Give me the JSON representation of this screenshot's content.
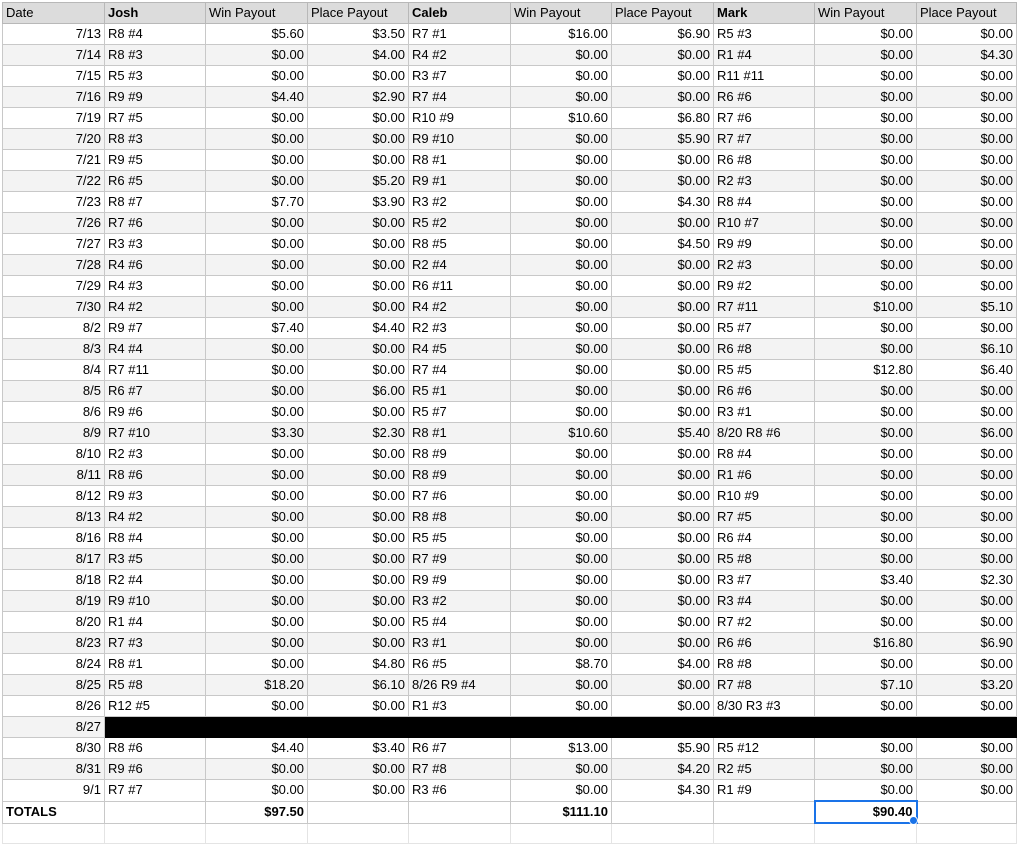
{
  "headers": [
    "Date",
    "Josh",
    "Win Payout",
    "Place Payout",
    "Caleb",
    "Win Payout",
    "Place Payout",
    "Mark",
    "Win Payout",
    "Place Payout"
  ],
  "bold_headers": [
    1,
    4,
    7
  ],
  "rows": [
    [
      "7/13",
      "R8 #4",
      "$5.60",
      "$3.50",
      "R7 #1",
      "$16.00",
      "$6.90",
      "R5 #3",
      "$0.00",
      "$0.00"
    ],
    [
      "7/14",
      "R8 #3",
      "$0.00",
      "$4.00",
      "R4 #2",
      "$0.00",
      "$0.00",
      "R1 #4",
      "$0.00",
      "$4.30"
    ],
    [
      "7/15",
      "R5 #3",
      "$0.00",
      "$0.00",
      "R3 #7",
      "$0.00",
      "$0.00",
      "R11 #11",
      "$0.00",
      "$0.00"
    ],
    [
      "7/16",
      "R9 #9",
      "$4.40",
      "$2.90",
      "R7 #4",
      "$0.00",
      "$0.00",
      "R6 #6",
      "$0.00",
      "$0.00"
    ],
    [
      "7/19",
      "R7 #5",
      "$0.00",
      "$0.00",
      "R10 #9",
      "$10.60",
      "$6.80",
      "R7 #6",
      "$0.00",
      "$0.00"
    ],
    [
      "7/20",
      "R8 #3",
      "$0.00",
      "$0.00",
      "R9 #10",
      "$0.00",
      "$5.90",
      "R7 #7",
      "$0.00",
      "$0.00"
    ],
    [
      "7/21",
      "R9 #5",
      "$0.00",
      "$0.00",
      "R8 #1",
      "$0.00",
      "$0.00",
      "R6 #8",
      "$0.00",
      "$0.00"
    ],
    [
      "7/22",
      "R6 #5",
      "$0.00",
      "$5.20",
      "R9 #1",
      "$0.00",
      "$0.00",
      "R2 #3",
      "$0.00",
      "$0.00"
    ],
    [
      "7/23",
      "R8 #7",
      "$7.70",
      "$3.90",
      "R3 #2",
      "$0.00",
      "$4.30",
      "R8 #4",
      "$0.00",
      "$0.00"
    ],
    [
      "7/26",
      "R7 #6",
      "$0.00",
      "$0.00",
      "R5 #2",
      "$0.00",
      "$0.00",
      "R10 #7",
      "$0.00",
      "$0.00"
    ],
    [
      "7/27",
      "R3 #3",
      "$0.00",
      "$0.00",
      "R8 #5",
      "$0.00",
      "$4.50",
      "R9 #9",
      "$0.00",
      "$0.00"
    ],
    [
      "7/28",
      "R4 #6",
      "$0.00",
      "$0.00",
      "R2 #4",
      "$0.00",
      "$0.00",
      "R2 #3",
      "$0.00",
      "$0.00"
    ],
    [
      "7/29",
      "R4 #3",
      "$0.00",
      "$0.00",
      "R6 #11",
      "$0.00",
      "$0.00",
      "R9 #2",
      "$0.00",
      "$0.00"
    ],
    [
      "7/30",
      "R4 #2",
      "$0.00",
      "$0.00",
      "R4 #2",
      "$0.00",
      "$0.00",
      "R7 #11",
      "$10.00",
      "$5.10"
    ],
    [
      "8/2",
      "R9 #7",
      "$7.40",
      "$4.40",
      "R2 #3",
      "$0.00",
      "$0.00",
      "R5 #7",
      "$0.00",
      "$0.00"
    ],
    [
      "8/3",
      "R4 #4",
      "$0.00",
      "$0.00",
      "R4 #5",
      "$0.00",
      "$0.00",
      "R6 #8",
      "$0.00",
      "$6.10"
    ],
    [
      "8/4",
      "R7 #11",
      "$0.00",
      "$0.00",
      "R7 #4",
      "$0.00",
      "$0.00",
      "R5 #5",
      "$12.80",
      "$6.40"
    ],
    [
      "8/5",
      "R6 #7",
      "$0.00",
      "$6.00",
      "R5 #1",
      "$0.00",
      "$0.00",
      "R6 #6",
      "$0.00",
      "$0.00"
    ],
    [
      "8/6",
      "R9 #6",
      "$0.00",
      "$0.00",
      "R5 #7",
      "$0.00",
      "$0.00",
      "R3 #1",
      "$0.00",
      "$0.00"
    ],
    [
      "8/9",
      "R7 #10",
      "$3.30",
      "$2.30",
      "R8 #1",
      "$10.60",
      "$5.40",
      "8/20 R8 #6",
      "$0.00",
      "$6.00"
    ],
    [
      "8/10",
      "R2 #3",
      "$0.00",
      "$0.00",
      "R8 #9",
      "$0.00",
      "$0.00",
      "R8 #4",
      "$0.00",
      "$0.00"
    ],
    [
      "8/11",
      "R8 #6",
      "$0.00",
      "$0.00",
      "R8 #9",
      "$0.00",
      "$0.00",
      "R1 #6",
      "$0.00",
      "$0.00"
    ],
    [
      "8/12",
      "R9 #3",
      "$0.00",
      "$0.00",
      "R7 #6",
      "$0.00",
      "$0.00",
      "R10 #9",
      "$0.00",
      "$0.00"
    ],
    [
      "8/13",
      "R4 #2",
      "$0.00",
      "$0.00",
      "R8 #8",
      "$0.00",
      "$0.00",
      "R7 #5",
      "$0.00",
      "$0.00"
    ],
    [
      "8/16",
      "R8 #4",
      "$0.00",
      "$0.00",
      "R5 #5",
      "$0.00",
      "$0.00",
      "R6 #4",
      "$0.00",
      "$0.00"
    ],
    [
      "8/17",
      "R3 #5",
      "$0.00",
      "$0.00",
      "R7 #9",
      "$0.00",
      "$0.00",
      "R5 #8",
      "$0.00",
      "$0.00"
    ],
    [
      "8/18",
      "R2 #4",
      "$0.00",
      "$0.00",
      "R9 #9",
      "$0.00",
      "$0.00",
      "R3 #7",
      "$3.40",
      "$2.30"
    ],
    [
      "8/19",
      "R9 #10",
      "$0.00",
      "$0.00",
      "R3 #2",
      "$0.00",
      "$0.00",
      "R3 #4",
      "$0.00",
      "$0.00"
    ],
    [
      "8/20",
      "R1 #4",
      "$0.00",
      "$0.00",
      "R5 #4",
      "$0.00",
      "$0.00",
      "R7 #2",
      "$0.00",
      "$0.00"
    ],
    [
      "8/23",
      "R7 #3",
      "$0.00",
      "$0.00",
      "R3 #1",
      "$0.00",
      "$0.00",
      "R6 #6",
      "$16.80",
      "$6.90"
    ],
    [
      "8/24",
      "R8 #1",
      "$0.00",
      "$4.80",
      "R6 #5",
      "$8.70",
      "$4.00",
      "R8 #8",
      "$0.00",
      "$0.00"
    ],
    [
      "8/25",
      "R5 #8",
      "$18.20",
      "$6.10",
      "8/26 R9 #4",
      "$0.00",
      "$0.00",
      "R7 #8",
      "$7.10",
      "$3.20"
    ],
    [
      "8/26",
      "R12 #5",
      "$0.00",
      "$0.00",
      "R1 #3",
      "$0.00",
      "$0.00",
      "8/30 R3 #3",
      "$0.00",
      "$0.00"
    ],
    [
      "8/27"
    ],
    [
      "8/30",
      "R8 #6",
      "$4.40",
      "$3.40",
      "R6 #7",
      "$13.00",
      "$5.90",
      "R5 #12",
      "$0.00",
      "$0.00"
    ],
    [
      "8/31",
      "R9 #6",
      "$0.00",
      "$0.00",
      "R7 #8",
      "$0.00",
      "$4.20",
      "R2 #5",
      "$0.00",
      "$0.00"
    ],
    [
      "9/1",
      "R7 #7",
      "$0.00",
      "$0.00",
      "R3 #6",
      "$0.00",
      "$4.30",
      "R1 #9",
      "$0.00",
      "$0.00"
    ]
  ],
  "totals": [
    "TOTALS",
    "",
    "$97.50",
    "",
    "",
    "$111.10",
    "",
    "",
    "$90.40",
    ""
  ],
  "selected_cell_color": "#1a73e8",
  "blackout_color": "#000000"
}
